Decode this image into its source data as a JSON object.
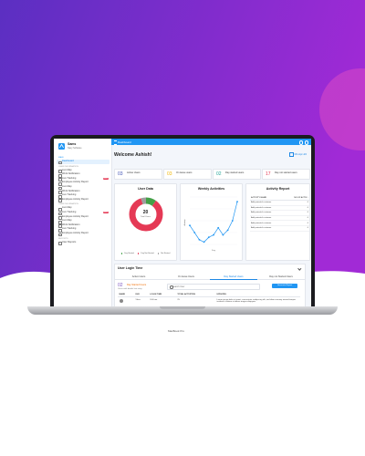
{
  "colors": {
    "purple_start": "#5b2fc2",
    "purple_end": "#a12ad6",
    "accent": "#2196f3",
    "danger": "#e53955"
  },
  "laptop_label": "MacBook Pro",
  "app": {
    "logo_title": "Sams",
    "logo_subtitle": "Navy Software",
    "topbar_title": "Dashboard",
    "sections": [
      {
        "title": "MAIN",
        "items": [
          {
            "label": "Dashboard",
            "active": true,
            "icon": "home-icon"
          }
        ]
      },
      {
        "title": "USER INFORMATION",
        "items": [
          {
            "label": "Live Map",
            "icon": "map-icon"
          },
          {
            "label": "Work Notification",
            "icon": "bell-icon"
          },
          {
            "label": "Live Tracking",
            "icon": "pin-icon",
            "badge": "NEW"
          },
          {
            "label": "Employee Activity Report",
            "icon": "report-icon"
          },
          {
            "label": "Live Map",
            "icon": "map-icon"
          },
          {
            "label": "Work Notification",
            "icon": "bell-icon"
          },
          {
            "label": "Live Tracking",
            "icon": "pin-icon"
          },
          {
            "label": "Employee Activity Report",
            "icon": "report-icon"
          }
        ]
      },
      {
        "title": "USER INFORMATION",
        "items": [
          {
            "label": "Live Map",
            "icon": "map-icon"
          },
          {
            "label": "Live Tracking",
            "icon": "pin-icon",
            "badge": "NEW"
          },
          {
            "label": "Employee Activity Report",
            "icon": "report-icon"
          },
          {
            "label": "Live Map",
            "icon": "map-icon"
          },
          {
            "label": "Work Notification",
            "icon": "bell-icon"
          },
          {
            "label": "Live Tracking",
            "icon": "pin-icon"
          },
          {
            "label": "Employee Activity Report",
            "icon": "report-icon"
          }
        ]
      },
      {
        "title": "REPORTS",
        "items": [
          {
            "label": "User Reports",
            "icon": "report-icon"
          }
        ]
      }
    ],
    "welcome": "Welcome Ashish!",
    "date": "06-Apr-20",
    "stats": [
      {
        "value": "03",
        "label": "Active Users",
        "color": "#3f51b5"
      },
      {
        "value": "03",
        "label": "On leave users",
        "color": "#f2b705"
      },
      {
        "value": "02",
        "label": "Day started users",
        "color": "#26a69a"
      },
      {
        "value": "17",
        "label": "Day not started users",
        "color": "#e53955"
      }
    ],
    "user_data": {
      "title": "User Data",
      "center_value": "20",
      "center_label": "Total Users",
      "legend": [
        "Day Started",
        "Day Not Started",
        "Not Started"
      ],
      "legend_colors": [
        "#43a047",
        "#e53955",
        "#9e9e9e"
      ]
    },
    "weekly": {
      "title": "Weekly Activities",
      "ylabel": "Activity",
      "xlabel": "Day"
    },
    "activity_report": {
      "title": "Activity Report",
      "col1": "ACTIVITY NAME",
      "col2": "NO OF ACTIV...",
      "rows": [
        {
          "name": "Add potential customer",
          "count": "0"
        },
        {
          "name": "Add potential customer",
          "count": "0"
        },
        {
          "name": "Add potential customer",
          "count": "0"
        },
        {
          "name": "Add potential customer",
          "count": "0"
        },
        {
          "name": "Add potential customer",
          "count": "0"
        },
        {
          "name": "Add potential customer",
          "count": "0"
        }
      ]
    },
    "login": {
      "title": "User Login Time",
      "tabs": [
        "Active Users",
        "On leave Users",
        "Day Started Users",
        "Day not Started Users"
      ],
      "count": "02",
      "count_label": "Day Started Users",
      "sub": "Users with details last entry",
      "search_placeholder": "Search User",
      "report_button": "Generate Report",
      "columns": [
        "NAME",
        "DAY",
        "LOGIN TIME",
        "TOTAL ACTIVITIES",
        "UPDATES"
      ],
      "row": {
        "name": "Vikas",
        "day": "",
        "login": "9:00 am",
        "total": "25",
        "updates": "Lorem ipsum dolor sit amet, consectetur sadipscing elit, sed diam nonumy eirmod tempor invidunt ut labore et dolore magna aliquyam"
      }
    }
  },
  "chart_data": [
    {
      "type": "pie",
      "title": "User Data",
      "categories": [
        "Day Started",
        "Day Not Started",
        "Not Started"
      ],
      "values": [
        2,
        17,
        1
      ]
    },
    {
      "type": "line",
      "title": "Weekly Activities",
      "xlabel": "Day",
      "ylabel": "Activity",
      "x": [
        1,
        2,
        3,
        4,
        5,
        6,
        7,
        8,
        9,
        10,
        11
      ],
      "series": [
        {
          "values": [
            40,
            25,
            10,
            5,
            15,
            20,
            35,
            20,
            30,
            50,
            90
          ]
        }
      ],
      "ylim": [
        0,
        100
      ]
    }
  ]
}
